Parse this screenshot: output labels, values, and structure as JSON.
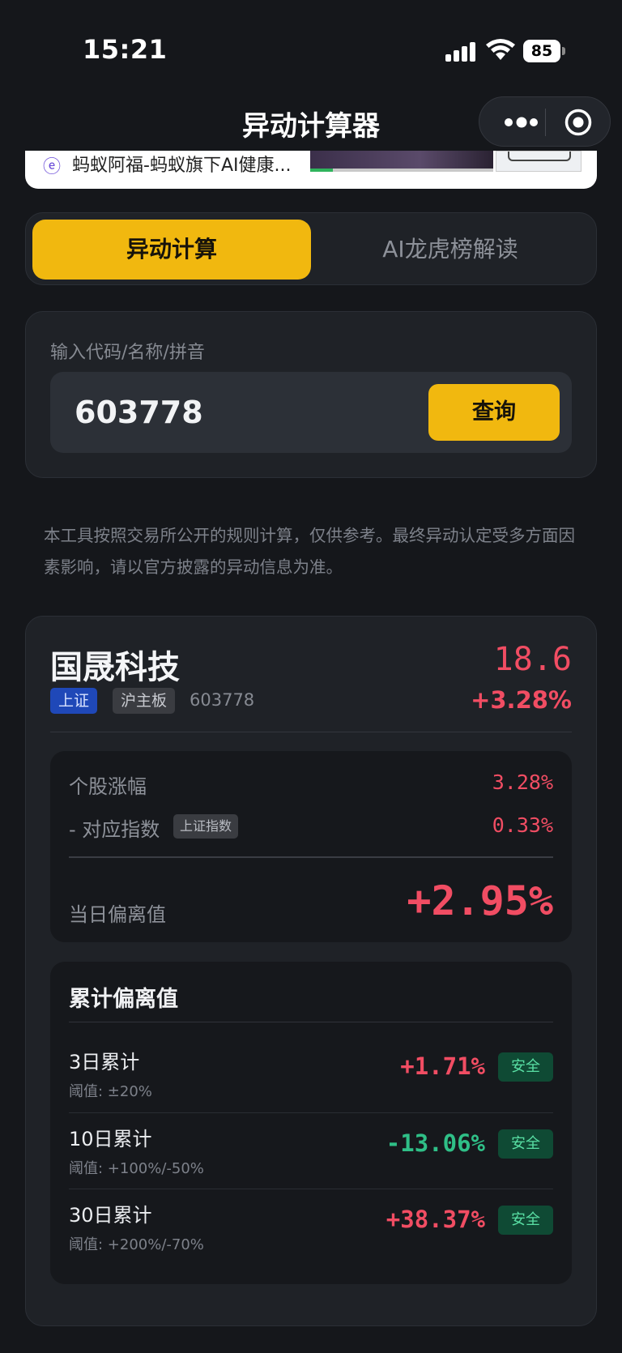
{
  "status_bar": {
    "time": "15:21",
    "battery": "85"
  },
  "nav": {
    "title": "异动计算器"
  },
  "ad": {
    "text": "蚂蚁阿福-蚂蚁旗下AI健康..."
  },
  "tabs": [
    {
      "label": "异动计算",
      "active": true
    },
    {
      "label": "AI龙虎榜解读",
      "active": false
    }
  ],
  "search": {
    "label": "输入代码/名称/拼音",
    "value": "603778",
    "button_label": "查询"
  },
  "disclaimer": "本工具按照交易所公开的规则计算，仅供参考。最终异动认定受多方面因素影响，请以官方披露的异动信息为准。",
  "stock": {
    "name": "国晟科技",
    "market_tag": "上证",
    "board_tag": "沪主板",
    "code": "603778",
    "price": "18.6",
    "change": "+3.28%"
  },
  "deviation": {
    "stock_change_label": "个股涨幅",
    "stock_change_value": "3.28%",
    "index_label": "- 对应指数",
    "index_tag": "上证指数",
    "index_value": "0.33%",
    "daily_label": "当日偏离值",
    "daily_value": "+2.95%"
  },
  "cumulative": {
    "title": "累计偏离值",
    "rows": [
      {
        "name": "3日累计",
        "threshold": "阈值: ±20%",
        "value": "+1.71%",
        "status": "安全",
        "direction": "up"
      },
      {
        "name": "10日累计",
        "threshold": "阈值: +100%/-50%",
        "value": "-13.06%",
        "status": "安全",
        "direction": "down"
      },
      {
        "name": "30日累计",
        "threshold": "阈值: +200%/-70%",
        "value": "+38.37%",
        "status": "安全",
        "direction": "up"
      }
    ]
  },
  "colors": {
    "accent": "#f1b80f",
    "up": "#f14d63",
    "down": "#2fbf87",
    "safe_bg": "#0f4a34"
  },
  "icons": {
    "more": "more-dots-icon",
    "close": "target-circle-icon",
    "signal": "cellular-signal-icon",
    "wifi": "wifi-icon",
    "battery": "battery-icon"
  }
}
